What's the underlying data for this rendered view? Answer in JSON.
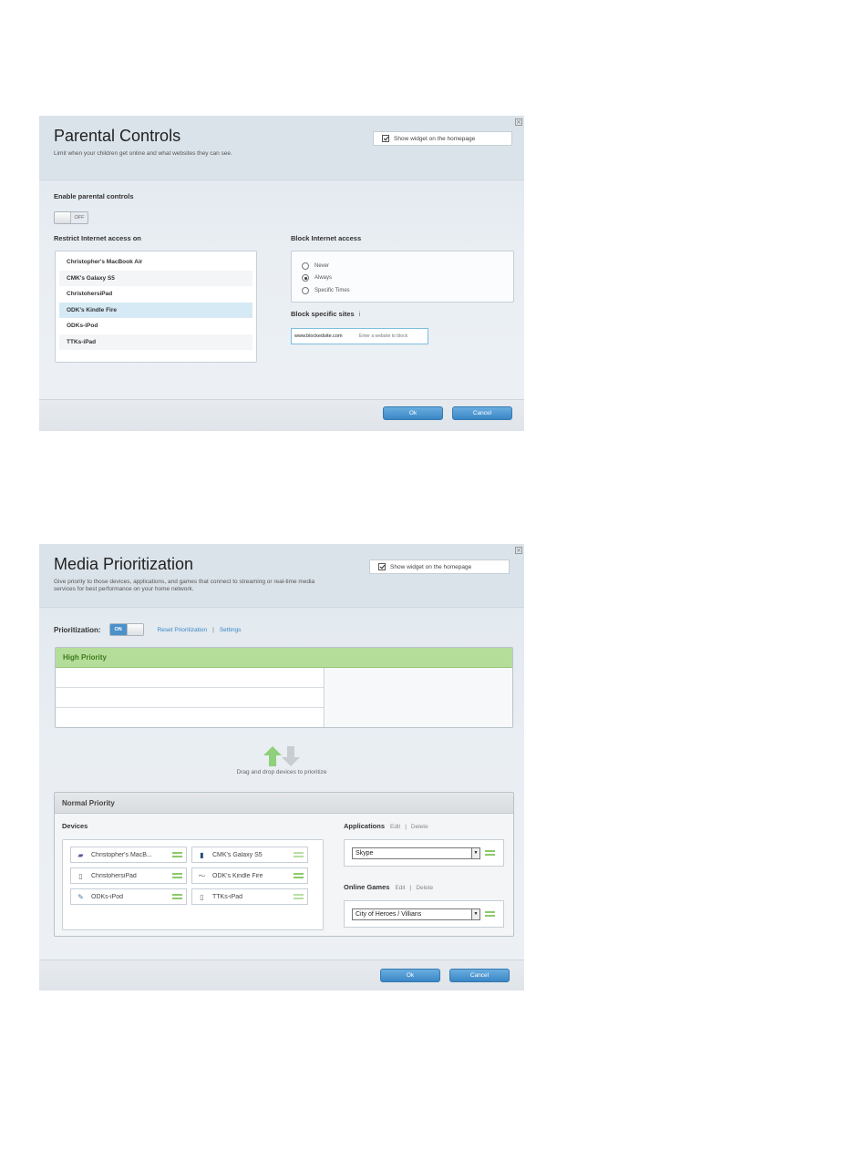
{
  "parental_controls": {
    "title": "Parental Controls",
    "subtitle": "Limit when your children get online and what websites they can see.",
    "show_widget_label": "Show widget on the homepage",
    "show_widget_checked": true,
    "enable_label": "Enable parental controls",
    "toggle_state": "OFF",
    "restrict_label": "Restrict Internet access on",
    "devices": [
      "Christopher's MacBook Air",
      "CMK's Galaxy S5",
      "ChristohersiPad",
      "ODK's Kindle Fire",
      "ODKs-iPod",
      "TTKs-iPad"
    ],
    "selected_device": "ODK's Kindle Fire",
    "block_access_label": "Block Internet access",
    "block_options": [
      "Never",
      "Always",
      "Specific Times"
    ],
    "block_selected": "Always",
    "block_sites_label": "Block specific sites",
    "info_glyph": "i",
    "blocked_site": "www.blockedsite.com",
    "site_placeholder": "Enter a website to block",
    "ok_label": "Ok",
    "cancel_label": "Cancel",
    "close_glyph": "×"
  },
  "media_prioritization": {
    "title": "Media Prioritization",
    "subtitle_line1": "Give priority to those devices, applications, and games that connect to streaming or real-time media",
    "subtitle_line2": "services for best performance on your home network.",
    "show_widget_label": "Show widget on the homepage",
    "show_widget_checked": true,
    "prioritization_label": "Prioritization:",
    "toggle_state": "ON",
    "reset_link": "Reset Prioritization",
    "separator": "|",
    "settings_link": "Settings",
    "high_priority_label": "High Priority",
    "drag_text": "Drag and drop devices to prioritize",
    "normal_priority_label": "Normal Priority",
    "devices_label": "Devices",
    "devices": [
      {
        "name": "Christopher's MacB...",
        "icon": "laptop-icon",
        "glyph": "▰"
      },
      {
        "name": "CMK's Galaxy S5",
        "icon": "phone-icon",
        "glyph": "▮"
      },
      {
        "name": "ChristohersiPad",
        "icon": "tablet-icon",
        "glyph": "▯"
      },
      {
        "name": "ODK's Kindle Fire",
        "icon": "kindle-icon",
        "glyph": "〜"
      },
      {
        "name": "ODKs-iPod",
        "icon": "ipod-icon",
        "glyph": "✎"
      },
      {
        "name": "TTKs-iPad",
        "icon": "tablet-icon",
        "glyph": "▯"
      }
    ],
    "applications_label": "Applications",
    "edit_link": "Edit",
    "delete_link": "Delete",
    "application_value": "Skype",
    "online_games_label": "Online Games",
    "game_value": "City of Heroes / Villians",
    "ok_label": "Ok",
    "cancel_label": "Cancel",
    "close_glyph": "×",
    "arrow_up_color": "#8fd07a",
    "arrow_down_color": "#c8cdd1"
  }
}
